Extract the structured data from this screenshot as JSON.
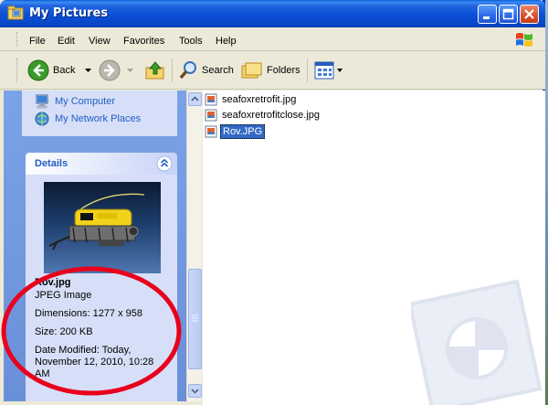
{
  "window": {
    "title": "My Pictures"
  },
  "menu": [
    "File",
    "Edit",
    "View",
    "Favorites",
    "Tools",
    "Help"
  ],
  "toolbar": {
    "back_label": "Back",
    "search_label": "Search",
    "folders_label": "Folders"
  },
  "other_places": [
    {
      "label": "My Computer",
      "icon": "computer-icon"
    },
    {
      "label": "My Network Places",
      "icon": "network-places-icon"
    }
  ],
  "details": {
    "heading": "Details",
    "file_name": "Rov.jpg",
    "file_type": "JPEG Image",
    "dimensions": "Dimensions: 1277 x 958",
    "size": "Size: 200 KB",
    "date_line1": "Date Modified: Today,",
    "date_line2": "November 12, 2010, 10:28",
    "date_line3": "AM"
  },
  "files": [
    {
      "name": "seafoxretrofit.jpg",
      "selected": false
    },
    {
      "name": "seafoxretrofitclose.jpg",
      "selected": false
    },
    {
      "name": "Rov.JPG",
      "selected": true
    }
  ],
  "colors": {
    "annotation": "#e8001c",
    "title_bar": "#0b4fd6",
    "task_pane": "#6a8fd8",
    "selection": "#316ac5"
  }
}
